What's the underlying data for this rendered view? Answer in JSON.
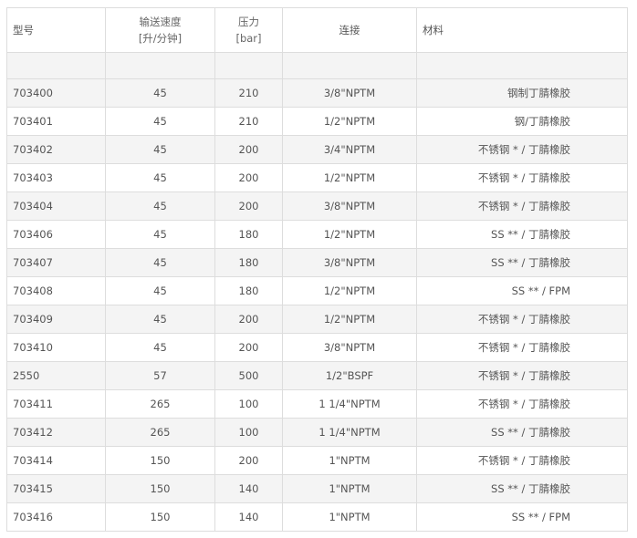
{
  "table": {
    "headers": {
      "model": "型号",
      "flow": "输送速度",
      "flow_unit": "[升/分钟]",
      "pressure": "压力",
      "pressure_unit": "[bar]",
      "connection": "连接",
      "material": "材料"
    },
    "rows": [
      {
        "model": "703400",
        "flow": "45",
        "pressure": "210",
        "connection": "3/8\"NPTM",
        "material": "钢制丁腈橡胶"
      },
      {
        "model": "703401",
        "flow": "45",
        "pressure": "210",
        "connection": "1/2\"NPTM",
        "material": "钢/丁腈橡胶"
      },
      {
        "model": "703402",
        "flow": "45",
        "pressure": "200",
        "connection": "3/4\"NPTM",
        "material": "不锈钢 * / 丁腈橡胶"
      },
      {
        "model": "703403",
        "flow": "45",
        "pressure": "200",
        "connection": "1/2\"NPTM",
        "material": "不锈钢 * / 丁腈橡胶"
      },
      {
        "model": "703404",
        "flow": "45",
        "pressure": "200",
        "connection": "3/8\"NPTM",
        "material": "不锈钢 * / 丁腈橡胶"
      },
      {
        "model": "703406",
        "flow": "45",
        "pressure": "180",
        "connection": "1/2\"NPTM",
        "material": "SS ** / 丁腈橡胶"
      },
      {
        "model": "703407",
        "flow": "45",
        "pressure": "180",
        "connection": "3/8\"NPTM",
        "material": "SS ** / 丁腈橡胶"
      },
      {
        "model": "703408",
        "flow": "45",
        "pressure": "180",
        "connection": "1/2\"NPTM",
        "material": "SS ** / FPM"
      },
      {
        "model": "703409",
        "flow": "45",
        "pressure": "200",
        "connection": "1/2\"NPTM",
        "material": "不锈钢 * / 丁腈橡胶"
      },
      {
        "model": "703410",
        "flow": "45",
        "pressure": "200",
        "connection": "3/8\"NPTM",
        "material": "不锈钢 * / 丁腈橡胶"
      },
      {
        "model": "2550",
        "flow": "57",
        "pressure": "500",
        "connection": "1/2\"BSPF",
        "material": "不锈钢 * / 丁腈橡胶"
      },
      {
        "model": "703411",
        "flow": "265",
        "pressure": "100",
        "connection": "1 1/4\"NPTM",
        "material": "不锈钢 * / 丁腈橡胶"
      },
      {
        "model": "703412",
        "flow": "265",
        "pressure": "100",
        "connection": "1 1/4\"NPTM",
        "material": "SS ** / 丁腈橡胶"
      },
      {
        "model": "703414",
        "flow": "150",
        "pressure": "200",
        "connection": "1\"NPTM",
        "material": "不锈钢 * / 丁腈橡胶"
      },
      {
        "model": "703415",
        "flow": "150",
        "pressure": "140",
        "connection": "1\"NPTM",
        "material": "SS ** / 丁腈橡胶"
      },
      {
        "model": "703416",
        "flow": "150",
        "pressure": "140",
        "connection": "1\"NPTM",
        "material": "SS ** / FPM"
      }
    ]
  }
}
